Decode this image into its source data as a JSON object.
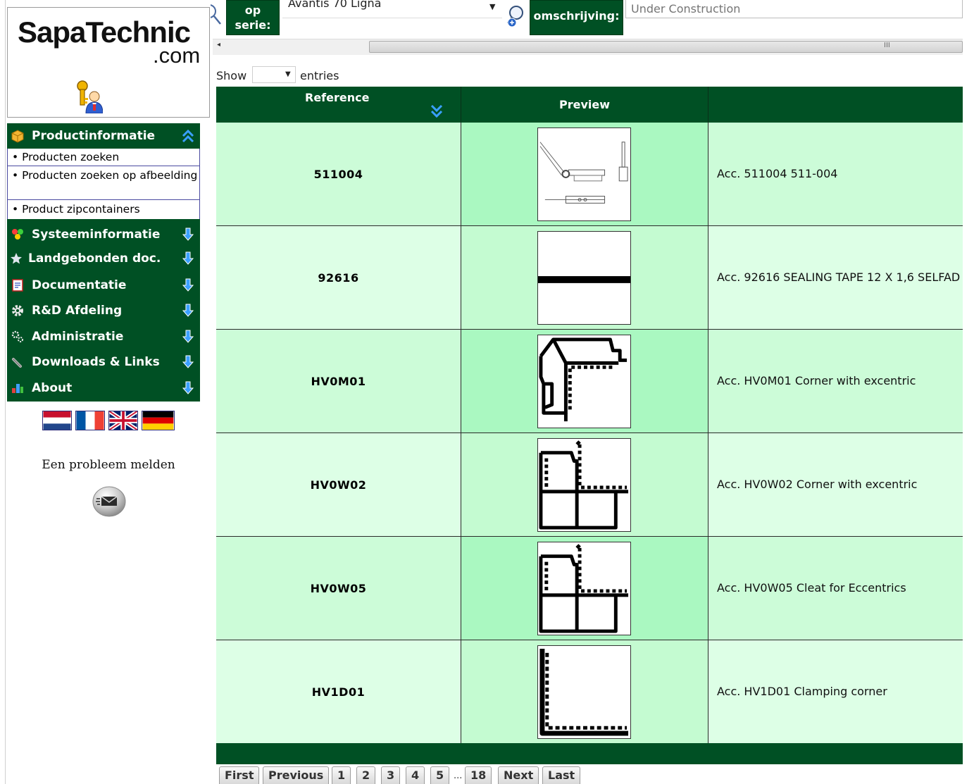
{
  "brand": {
    "name": "SapaTechnic",
    "suffix": ".com"
  },
  "sidebar": {
    "open_section": {
      "label": "Productinformatie",
      "icon": "box-icon"
    },
    "sub_items": [
      {
        "label": "• Producten zoeken"
      },
      {
        "label": "• Producten zoeken op afbeelding"
      },
      {
        "label": "• Product zipcontainers"
      }
    ],
    "sections": [
      {
        "label": "Systeeminformatie",
        "icon": "system-icon"
      },
      {
        "label": "Landgebonden doc.",
        "icon": "star-icon"
      },
      {
        "label": "Documentatie",
        "icon": "document-icon"
      },
      {
        "label": "R&D Afdeling",
        "icon": "gear-icon"
      },
      {
        "label": "Administratie",
        "icon": "gears-icon"
      },
      {
        "label": "Downloads & Links",
        "icon": "link-icon"
      },
      {
        "label": "About",
        "icon": "about-icon"
      }
    ],
    "report_problem": "Een probleem melden"
  },
  "filters": {
    "series_label": "op serie:",
    "series_value": "Avantis 70 Ligna",
    "description_label": "omschrijving:",
    "description_placeholder": "Under Construction"
  },
  "table": {
    "show_label": "Show",
    "entries_label": "entries",
    "columns": {
      "reference": "Reference",
      "preview": "Preview",
      "description": ""
    },
    "rows": [
      {
        "reference": "511004",
        "description": "Acc. 511004 511-004"
      },
      {
        "reference": "92616",
        "description": "Acc. 92616 SEALING TAPE 12 X 1,6 SELFAD"
      },
      {
        "reference": "HV0M01",
        "description": "Acc. HV0M01 Corner with excentric"
      },
      {
        "reference": "HV0W02",
        "description": "Acc. HV0W02 Corner with excentric"
      },
      {
        "reference": "HV0W05",
        "description": "Acc. HV0W05 Cleat for Eccentrics"
      },
      {
        "reference": "HV1D01",
        "description": "Acc. HV1D01 Clamping corner"
      }
    ]
  },
  "pagination": {
    "first": "First",
    "previous": "Previous",
    "pages": [
      "1",
      "2",
      "3",
      "4",
      "5"
    ],
    "ellipsis": "...",
    "last_page": "18",
    "next": "Next",
    "last": "Last"
  },
  "colors": {
    "header_green": "#005024",
    "row_light": "#ccfcd8",
    "row_mid": "#aaf8c1",
    "row_light_alt": "#ddffe6"
  }
}
